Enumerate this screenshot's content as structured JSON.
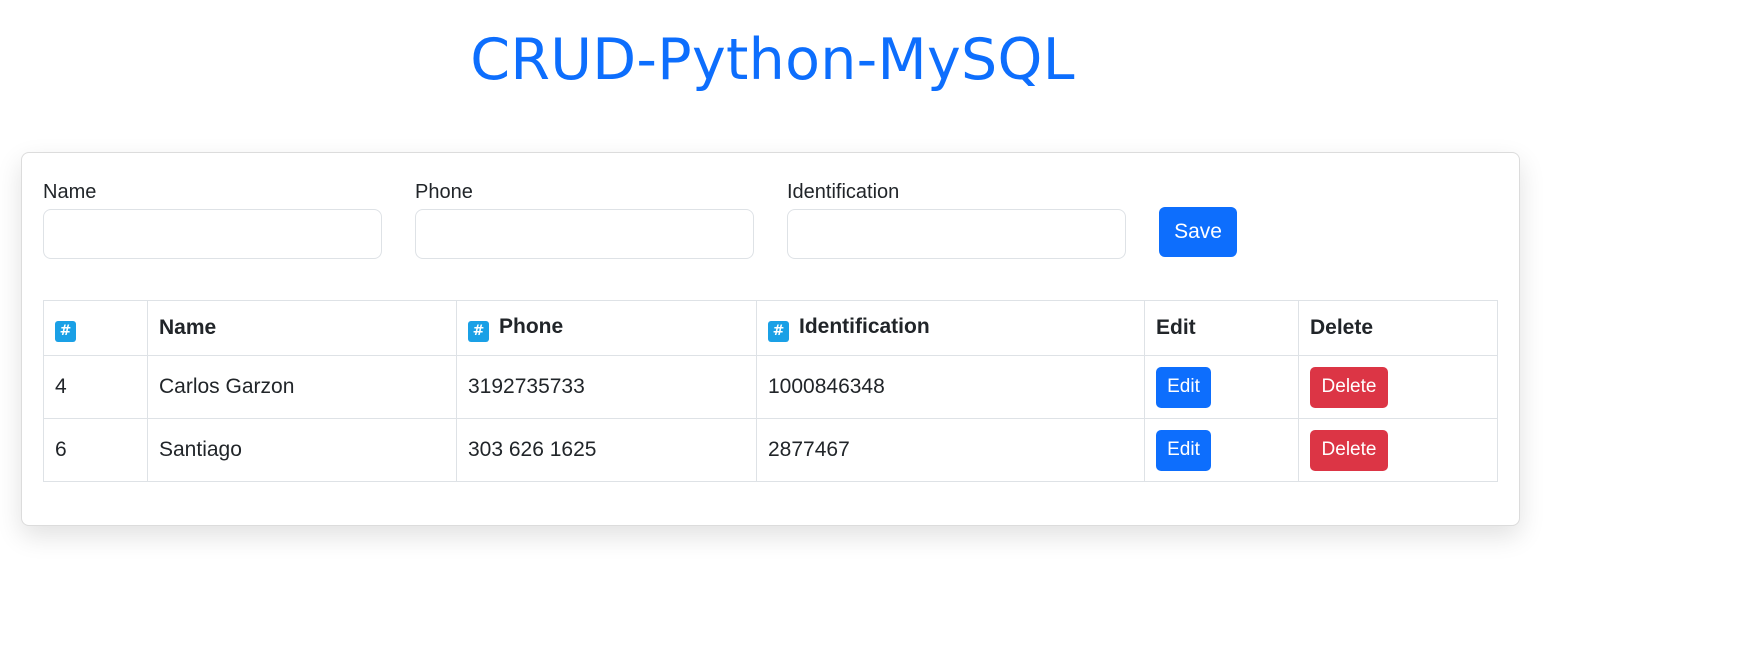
{
  "header": {
    "title": "CRUD-Python-MySQL"
  },
  "form": {
    "name_label": "Name",
    "name_value": "",
    "phone_label": "Phone",
    "phone_value": "",
    "identification_label": "Identification",
    "identification_value": "",
    "save_label": "Save"
  },
  "table": {
    "columns": {
      "id": "",
      "name": "Name",
      "phone": "Phone",
      "identification": "Identification",
      "edit": "Edit",
      "delete": "Delete"
    },
    "column_icons": {
      "id": "hash-icon",
      "phone": "hash-icon",
      "identification": "hash-icon"
    },
    "rows": [
      {
        "id": "4",
        "name": "Carlos Garzon",
        "phone": "3192735733",
        "identification": "1000846348",
        "edit_label": "Edit",
        "delete_label": "Delete"
      },
      {
        "id": "6",
        "name": "Santiago",
        "phone": "303 626 1625",
        "identification": "2877467",
        "edit_label": "Edit",
        "delete_label": "Delete"
      }
    ]
  },
  "colors": {
    "primary": "#0d6efd",
    "danger": "#dc3545",
    "icon": "#1aa0e6"
  }
}
